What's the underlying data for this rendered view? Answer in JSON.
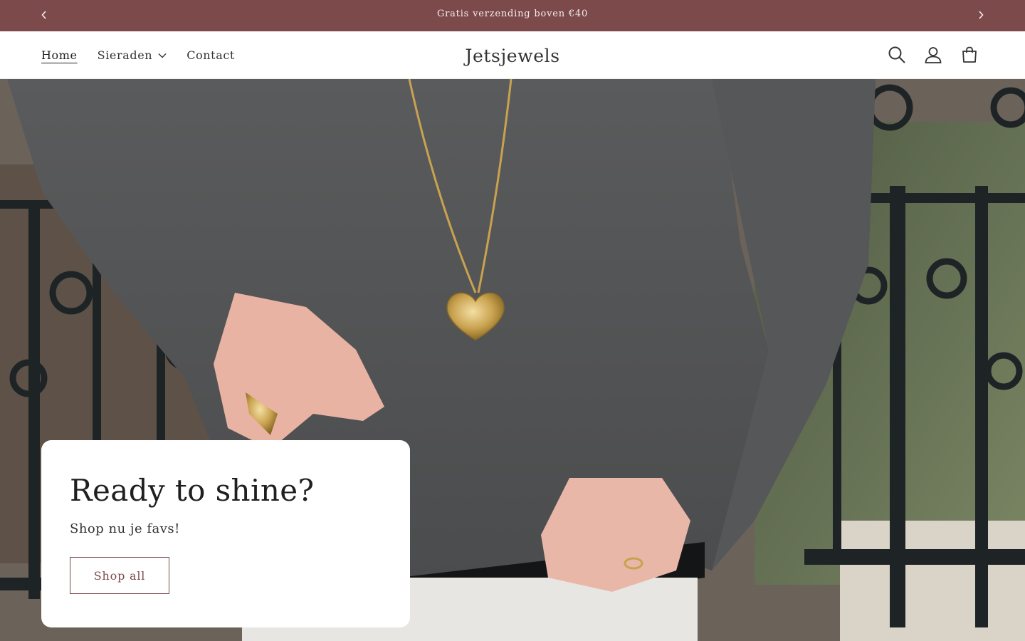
{
  "announcement": {
    "message": "Gratis verzending boven €40",
    "bg_color": "#7d4a4c",
    "prev_icon": "chevron-left-icon",
    "next_icon": "chevron-right-icon"
  },
  "header": {
    "nav": [
      {
        "label": "Home",
        "active": true
      },
      {
        "label": "Sieraden",
        "has_dropdown": true
      },
      {
        "label": "Contact"
      }
    ],
    "logo": "Jetsjewels",
    "icons": [
      "search-icon",
      "account-icon",
      "cart-icon"
    ]
  },
  "hero": {
    "image": "woman in grey sweater with gold heart locket necklace and gold rings, wrought iron railing background",
    "card": {
      "heading": "Ready to shine?",
      "subheading": "Shop nu je favs!",
      "button_label": "Shop all"
    }
  },
  "colors": {
    "accent": "#7d4a4c",
    "text": "#222222"
  }
}
